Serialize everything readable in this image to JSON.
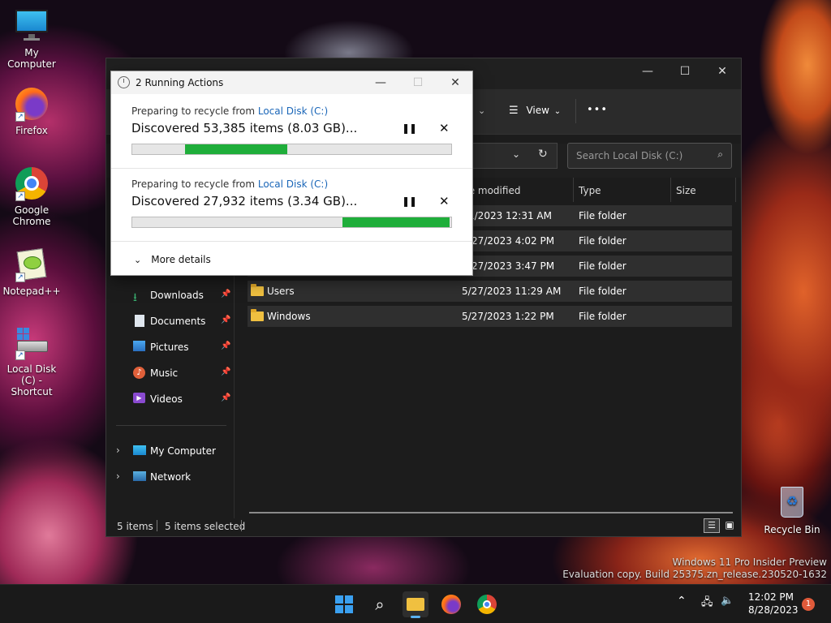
{
  "desktop": {
    "icons": [
      {
        "label": "My Computer"
      },
      {
        "label": "Firefox"
      },
      {
        "label": "Google Chrome"
      },
      {
        "label": "Notepad++"
      },
      {
        "label": "Local Disk (C) - Shortcut"
      },
      {
        "label": "Recycle Bin"
      }
    ],
    "watermark_line1": "Windows 11 Pro Insider Preview",
    "watermark_line2": "Evaluation copy. Build 25375.zn_release.230520-1632"
  },
  "explorer": {
    "toolbar": {
      "view_label": "View",
      "more_label": "•••"
    },
    "search_placeholder": "Search Local Disk (C:)",
    "columns": {
      "date": "te modified",
      "type": "Type",
      "size": "Size"
    },
    "nav": [
      {
        "label": "Downloads"
      },
      {
        "label": "Documents"
      },
      {
        "label": "Pictures"
      },
      {
        "label": "Music"
      },
      {
        "label": "Videos"
      },
      {
        "label": "My Computer"
      },
      {
        "label": "Network"
      }
    ],
    "rows": [
      {
        "name": "",
        "date": "1/2023 12:31 AM",
        "type": "File folder"
      },
      {
        "name": "",
        "date": "/27/2023 4:02 PM",
        "type": "File folder"
      },
      {
        "name": "",
        "date": "/27/2023 3:47 PM",
        "type": "File folder"
      },
      {
        "name": "Users",
        "date": "5/27/2023 11:29 AM",
        "type": "File folder"
      },
      {
        "name": "Windows",
        "date": "5/27/2023 1:22 PM",
        "type": "File folder"
      }
    ],
    "status": {
      "items": "5 items",
      "selected": "5 items selected"
    }
  },
  "dialog": {
    "title": "2 Running Actions",
    "operations": [
      {
        "prefix": "Preparing to recycle from ",
        "source": "Local Disk (C:)",
        "main": "Discovered 53,385 items (8.03 GB)...",
        "progress_start": 0.165,
        "progress_end": 0.485
      },
      {
        "prefix": "Preparing to recycle from ",
        "source": "Local Disk (C:)",
        "main": "Discovered 27,932 items (3.34 GB)...",
        "progress_start": 0.66,
        "progress_end": 0.995
      }
    ],
    "more_details": "More details"
  },
  "taskbar": {
    "time": "12:02 PM",
    "date": "8/28/2023",
    "notification_count": "1"
  },
  "colors": {
    "progress": "#1fae3a",
    "link": "#1a66b8",
    "accent": "#0078d4"
  }
}
